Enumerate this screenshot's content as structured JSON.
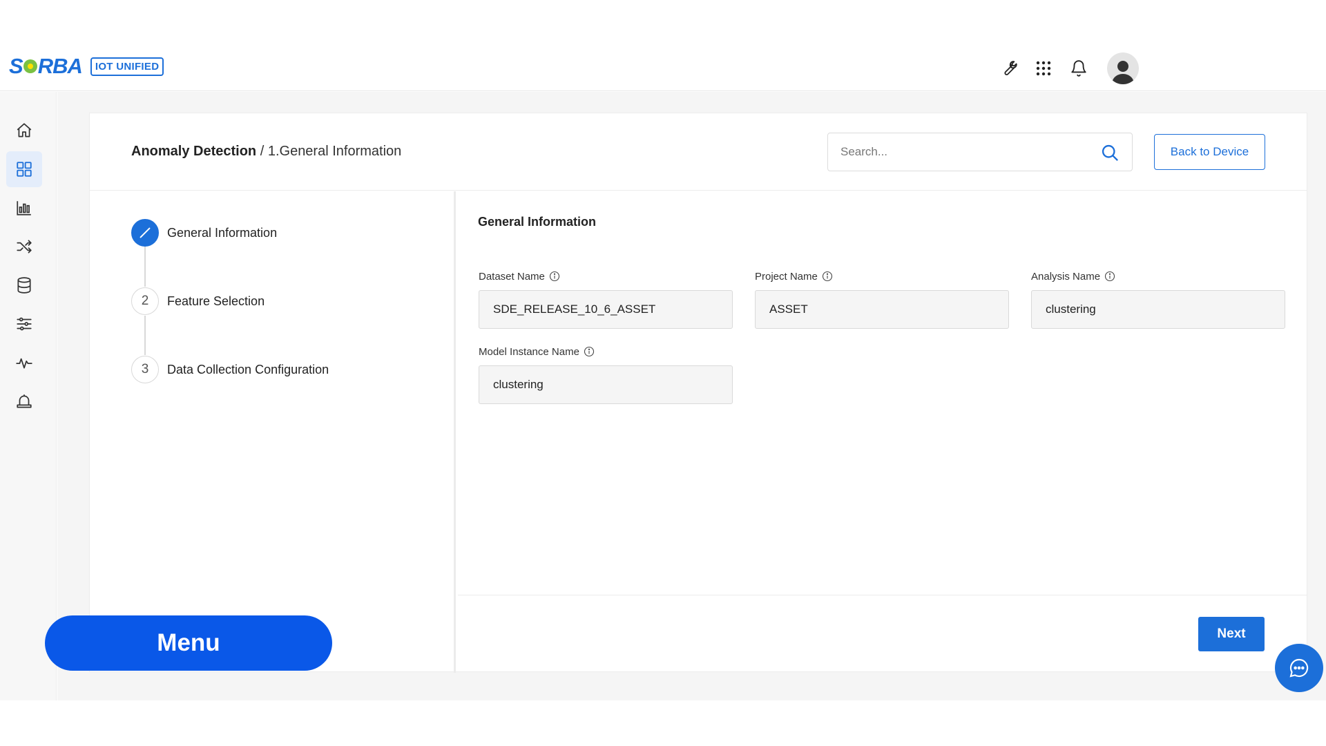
{
  "brand": {
    "logo_text_left": "S",
    "logo_text_right": "RBA",
    "badge": "IOT UNIFIED"
  },
  "header_icons": [
    "wrench-icon",
    "apps-grid-icon",
    "bell-icon",
    "user-avatar"
  ],
  "sidebar": {
    "items": [
      {
        "name": "home-icon",
        "active": false
      },
      {
        "name": "dashboard-icon",
        "active": true
      },
      {
        "name": "bar-chart-icon",
        "active": false
      },
      {
        "name": "shuffle-icon",
        "active": false
      },
      {
        "name": "database-icon",
        "active": false
      },
      {
        "name": "sliders-icon",
        "active": false
      },
      {
        "name": "activity-icon",
        "active": false
      },
      {
        "name": "alarm-icon",
        "active": false
      }
    ]
  },
  "breadcrumb": {
    "root": "Anomaly Detection",
    "separator": " / ",
    "current": "1.General Information"
  },
  "search": {
    "placeholder": "Search..."
  },
  "back_button": "Back to Device",
  "stepper": {
    "steps": [
      {
        "number": "1",
        "label": "General Information",
        "active": true
      },
      {
        "number": "2",
        "label": "Feature Selection",
        "active": false
      },
      {
        "number": "3",
        "label": "Data Collection Configuration",
        "active": false
      }
    ]
  },
  "form": {
    "title": "General Information",
    "fields": [
      {
        "label": "Dataset Name",
        "value": "SDE_RELEASE_10_6_ASSET"
      },
      {
        "label": "Project Name",
        "value": "ASSET"
      },
      {
        "label": "Analysis Name",
        "value": "clustering"
      },
      {
        "label": "Model Instance Name",
        "value": "clustering"
      }
    ]
  },
  "next_button": "Next",
  "menu_button": "Menu",
  "colors": {
    "accent": "#1c6fd9",
    "menu_blue": "#0a58e8",
    "logo_green": "#7ac143"
  }
}
